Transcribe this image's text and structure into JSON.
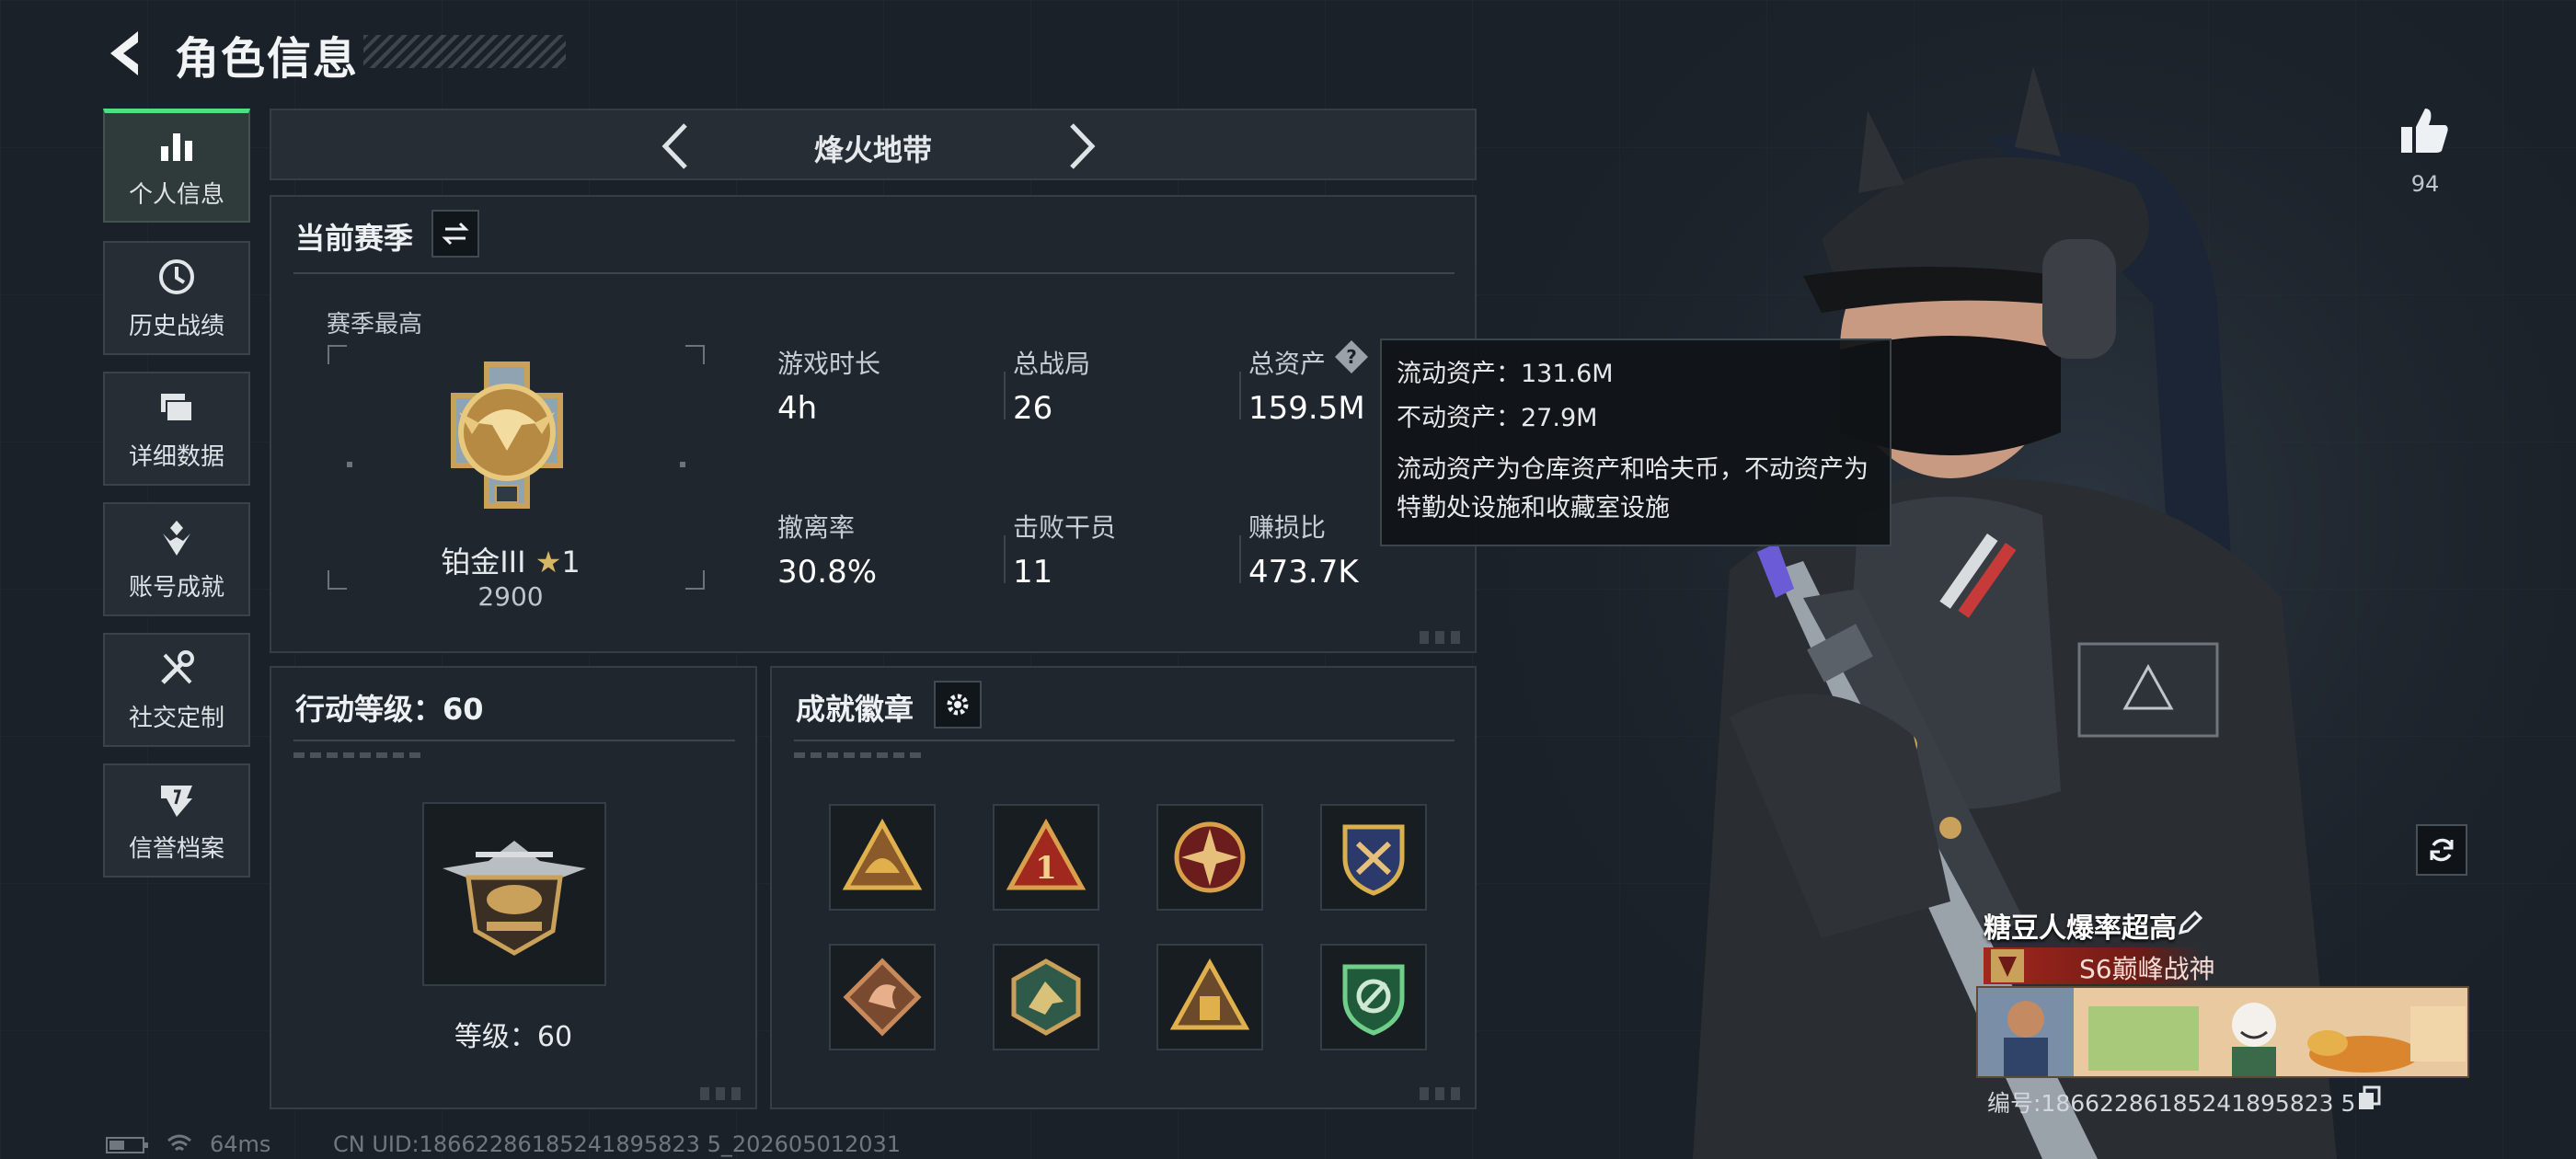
{
  "header": {
    "title": "角色信息"
  },
  "nav": {
    "items": [
      {
        "label": "个人信息",
        "icon": "bar-chart-icon",
        "active": true
      },
      {
        "label": "历史战绩",
        "icon": "clock-icon",
        "active": false
      },
      {
        "label": "详细数据",
        "icon": "folder-icon",
        "active": false
      },
      {
        "label": "账号成就",
        "icon": "achievement-icon",
        "active": false
      },
      {
        "label": "社交定制",
        "icon": "tools-icon",
        "active": false
      },
      {
        "label": "信誉档案",
        "icon": "credit-icon",
        "active": false
      }
    ]
  },
  "mode": {
    "title": "烽火地带"
  },
  "season": {
    "title": "当前赛季",
    "best_label": "赛季最高",
    "rank_name": "铂金III",
    "rank_stars": "1",
    "rank_points": "2900",
    "stats": [
      {
        "label": "游戏时长",
        "value": "4h"
      },
      {
        "label": "总战局",
        "value": "26"
      },
      {
        "label": "总资产",
        "value": "159.5M"
      },
      {
        "label": "撤离率",
        "value": "30.8%"
      },
      {
        "label": "击败干员",
        "value": "11"
      },
      {
        "label": "赚损比",
        "value": "473.7K"
      }
    ]
  },
  "tooltip": {
    "line1": "流动资产：131.6M",
    "line2": "不动资产：27.9M",
    "desc": "流动资产为仓库资产和哈夫币，不动资产为特勤处设施和收藏室设施"
  },
  "action": {
    "title": "行动等级：60",
    "level_label": "等级：60"
  },
  "badges": {
    "title": "成就徽章"
  },
  "profile": {
    "likes": "94",
    "name": "糖豆人爆率超高",
    "title": "S6巅峰战神",
    "id_label": "编号:18662286185241895823 5"
  },
  "footer": {
    "ping": "64ms",
    "uid": "CN UID:18662286185241895823 5_202605012031"
  },
  "colors": {
    "accent_green": "#4fe07d",
    "gold": "#c9a15a",
    "tooltip_bg": "#101317"
  }
}
